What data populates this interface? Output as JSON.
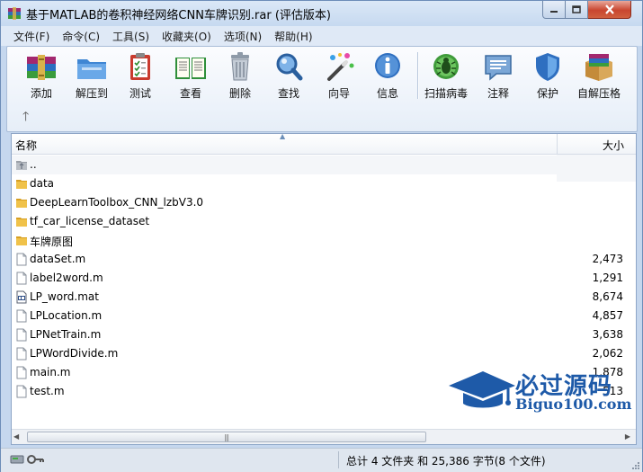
{
  "window": {
    "title": "基于MATLAB的卷积神经网络CNN车牌识别.rar (评估版本)"
  },
  "menu": [
    "文件(F)",
    "命令(C)",
    "工具(S)",
    "收藏夹(O)",
    "选项(N)",
    "帮助(H)"
  ],
  "toolbar": {
    "add": "添加",
    "extract": "解压到",
    "test": "测试",
    "view": "查看",
    "delete": "删除",
    "find": "查找",
    "wizard": "向导",
    "info": "信息",
    "virus_scan": "扫描病毒",
    "comment": "注释",
    "protect": "保护",
    "sfx": "自解压格"
  },
  "list": {
    "columns": {
      "name": "名称",
      "size": "大小"
    },
    "rows": [
      {
        "name": "..",
        "type": "parent",
        "size": ""
      },
      {
        "name": "data",
        "type": "folder",
        "size": ""
      },
      {
        "name": "DeepLearnToolbox_CNN_lzbV3.0",
        "type": "folder",
        "size": ""
      },
      {
        "name": "tf_car_license_dataset",
        "type": "folder",
        "size": ""
      },
      {
        "name": "车牌原图",
        "type": "folder",
        "size": ""
      },
      {
        "name": "dataSet.m",
        "type": "file",
        "size": "2,473"
      },
      {
        "name": "label2word.m",
        "type": "file",
        "size": "1,291"
      },
      {
        "name": "LP_word.mat",
        "type": "mat",
        "size": "8,674"
      },
      {
        "name": "LPLocation.m",
        "type": "file",
        "size": "4,857"
      },
      {
        "name": "LPNetTrain.m",
        "type": "file",
        "size": "3,638"
      },
      {
        "name": "LPWordDivide.m",
        "type": "file",
        "size": "2,062"
      },
      {
        "name": "main.m",
        "type": "file",
        "size": "1,878"
      },
      {
        "name": "test.m",
        "type": "file",
        "size": "513"
      }
    ]
  },
  "status": {
    "summary": "总计 4 文件夹 和 25,386 字节(8 个文件)"
  },
  "watermark": {
    "title": "必过源码",
    "site": "Biguo100.com"
  },
  "colors": {
    "accent": "#1e5aa8",
    "folder": "#e8b830",
    "close_button": "#c9462f"
  }
}
